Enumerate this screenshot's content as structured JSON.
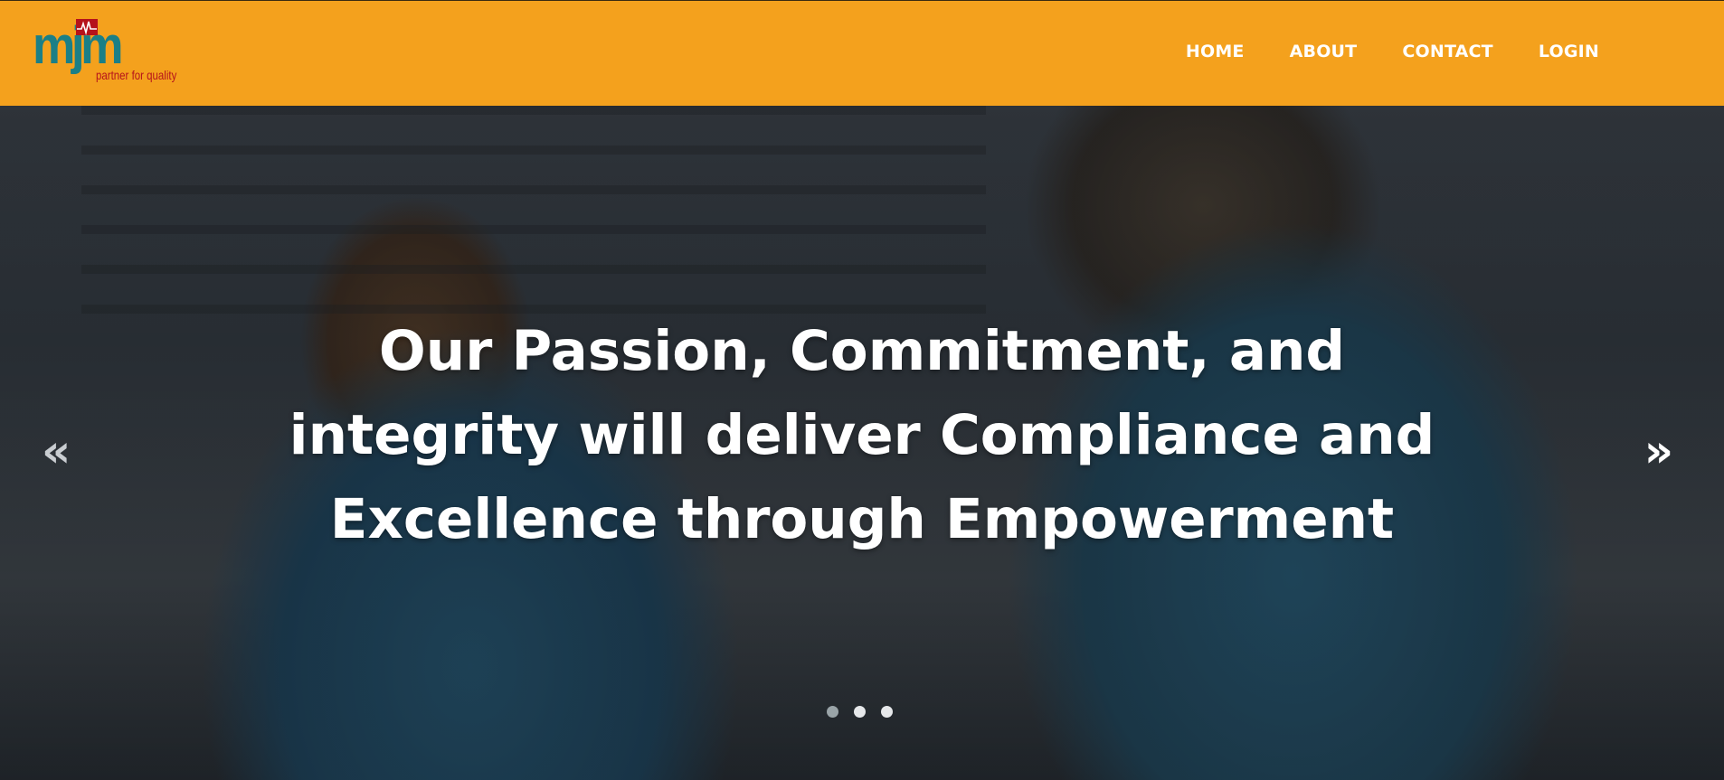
{
  "brand": {
    "logo_text": "mjm",
    "tagline": "partner for quality",
    "colors": {
      "header_bg": "#f4a11d",
      "logo_teal": "#1b7f86",
      "logo_red": "#b5121b"
    }
  },
  "nav": {
    "items": [
      {
        "label": "HOME"
      },
      {
        "label": "ABOUT"
      },
      {
        "label": "CONTACT"
      },
      {
        "label": "LOGIN"
      }
    ]
  },
  "hero": {
    "lines": [
      "Our Passion, Commitment, and",
      "integrity will deliver Compliance and",
      "Excellence through Empowerment"
    ],
    "prev_icon": "double-chevron-left-icon",
    "prev_glyph": "«",
    "next_icon": "double-chevron-right-icon",
    "next_glyph": "»",
    "slides_count": 3,
    "active_slide": 1
  }
}
